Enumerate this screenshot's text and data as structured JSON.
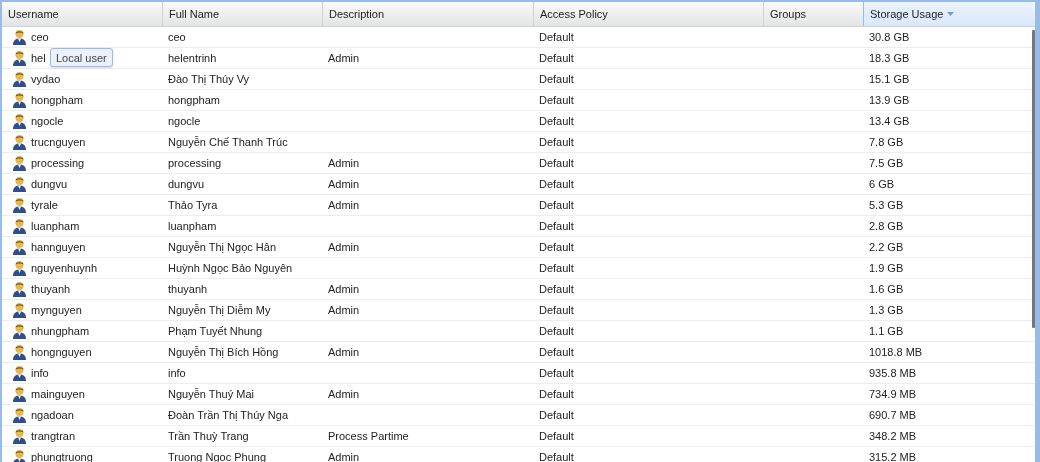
{
  "table": {
    "columns": [
      {
        "label": "Username",
        "sorted": false
      },
      {
        "label": "Full Name",
        "sorted": false
      },
      {
        "label": "Description",
        "sorted": false
      },
      {
        "label": "Access Policy",
        "sorted": false
      },
      {
        "label": "Groups",
        "sorted": false
      },
      {
        "label": "Storage Usage",
        "sorted": true
      }
    ],
    "rows": [
      {
        "username": "ceo",
        "full_name": "ceo",
        "access_policy": "Default",
        "storage": "30.8 GB"
      },
      {
        "username": "hel",
        "full_name": "helentrinh",
        "description": "Admin",
        "access_policy": "Default",
        "storage": "18.3 GB",
        "tooltip": "Local user"
      },
      {
        "username": "vydao",
        "full_name": "Đào Thị Thúy Vy",
        "access_policy": "Default",
        "storage": "15.1 GB"
      },
      {
        "username": "hongpham",
        "full_name": "hongpham",
        "access_policy": "Default",
        "storage": "13.9 GB"
      },
      {
        "username": "ngocle",
        "full_name": "ngocle",
        "access_policy": "Default",
        "storage": "13.4 GB"
      },
      {
        "username": "trucnguyen",
        "full_name": "Nguyễn Chế Thanh Trúc",
        "access_policy": "Default",
        "storage": "7.8 GB"
      },
      {
        "username": "processing",
        "full_name": "processing",
        "description": "Admin",
        "access_policy": "Default",
        "storage": "7.5 GB"
      },
      {
        "username": "dungvu",
        "full_name": "dungvu",
        "description": "Admin",
        "access_policy": "Default",
        "storage": "6 GB"
      },
      {
        "username": "tyrale",
        "full_name": "Thảo Tyra",
        "description": "Admin",
        "access_policy": "Default",
        "storage": "5.3 GB"
      },
      {
        "username": "luanpham",
        "full_name": "luanpham",
        "access_policy": "Default",
        "storage": "2.8 GB"
      },
      {
        "username": "hannguyen",
        "full_name": "Nguyễn Thị Ngọc Hân",
        "description": "Admin",
        "access_policy": "Default",
        "storage": "2.2 GB"
      },
      {
        "username": "nguyenhuynh",
        "full_name": "Huỳnh Ngọc Bảo Nguyên",
        "access_policy": "Default",
        "storage": "1.9 GB"
      },
      {
        "username": "thuyanh",
        "full_name": "thuyanh",
        "description": "Admin",
        "access_policy": "Default",
        "storage": "1.6 GB"
      },
      {
        "username": "mynguyen",
        "full_name": "Nguyễn Thị Diễm My",
        "description": "Admin",
        "access_policy": "Default",
        "storage": "1.3 GB"
      },
      {
        "username": "nhungpham",
        "full_name": "Phạm Tuyết Nhung",
        "access_policy": "Default",
        "storage": "1.1 GB"
      },
      {
        "username": "hongnguyen",
        "full_name": "Nguyễn Thị Bích Hồng",
        "description": "Admin",
        "access_policy": "Default",
        "storage": "1018.8 MB"
      },
      {
        "username": "info",
        "full_name": "info",
        "access_policy": "Default",
        "storage": "935.8 MB"
      },
      {
        "username": "mainguyen",
        "full_name": "Nguyễn Thuý Mai",
        "description": "Admin",
        "access_policy": "Default",
        "storage": "734.9 MB"
      },
      {
        "username": "ngadoan",
        "full_name": "Đoàn Trần Thị Thúy Nga",
        "access_policy": "Default",
        "storage": "690.7 MB"
      },
      {
        "username": "trangtran",
        "full_name": "Trần Thuỳ Trang",
        "description": "Process Partime",
        "access_policy": "Default",
        "storage": "348.2 MB"
      },
      {
        "username": "phungtruong",
        "full_name": "Truong Ngoc Phung",
        "description": "Admin",
        "access_policy": "Default",
        "storage": "315.2 MB"
      }
    ]
  }
}
